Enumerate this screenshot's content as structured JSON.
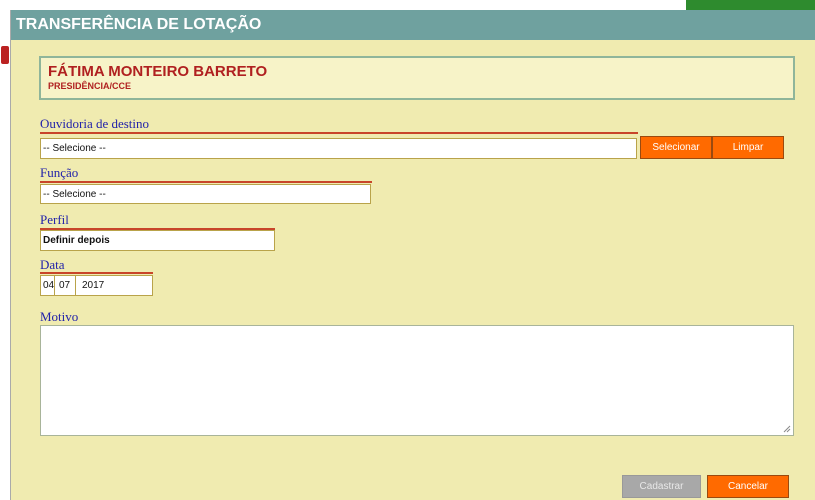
{
  "dialog": {
    "title": "TRANSFERÊNCIA DE LOTAÇÃO"
  },
  "person": {
    "name": "FÁTIMA MONTEIRO BARRETO",
    "department": "PRESIDÊNCIA/CCE"
  },
  "ouvidoria": {
    "label": "Ouvidoria de destino",
    "selected": "-- Selecione --",
    "select_button": "Selecionar",
    "clear_button": "Limpar"
  },
  "funcao": {
    "label": "Função",
    "selected": "-- Selecione --"
  },
  "perfil": {
    "label": "Perfil",
    "value": "Definir depois"
  },
  "data": {
    "label": "Data",
    "day": "04",
    "month": "07",
    "year": "2017"
  },
  "motivo": {
    "label": "Motivo",
    "value": ""
  },
  "actions": {
    "submit": "Cadastrar",
    "cancel": "Cancelar"
  },
  "colors": {
    "titlebar": "#6fa19f",
    "dialog_bg": "#f0ebb0",
    "accent_button": "#ff6a00",
    "name_text": "#b02020",
    "label_text": "#2222aa"
  }
}
